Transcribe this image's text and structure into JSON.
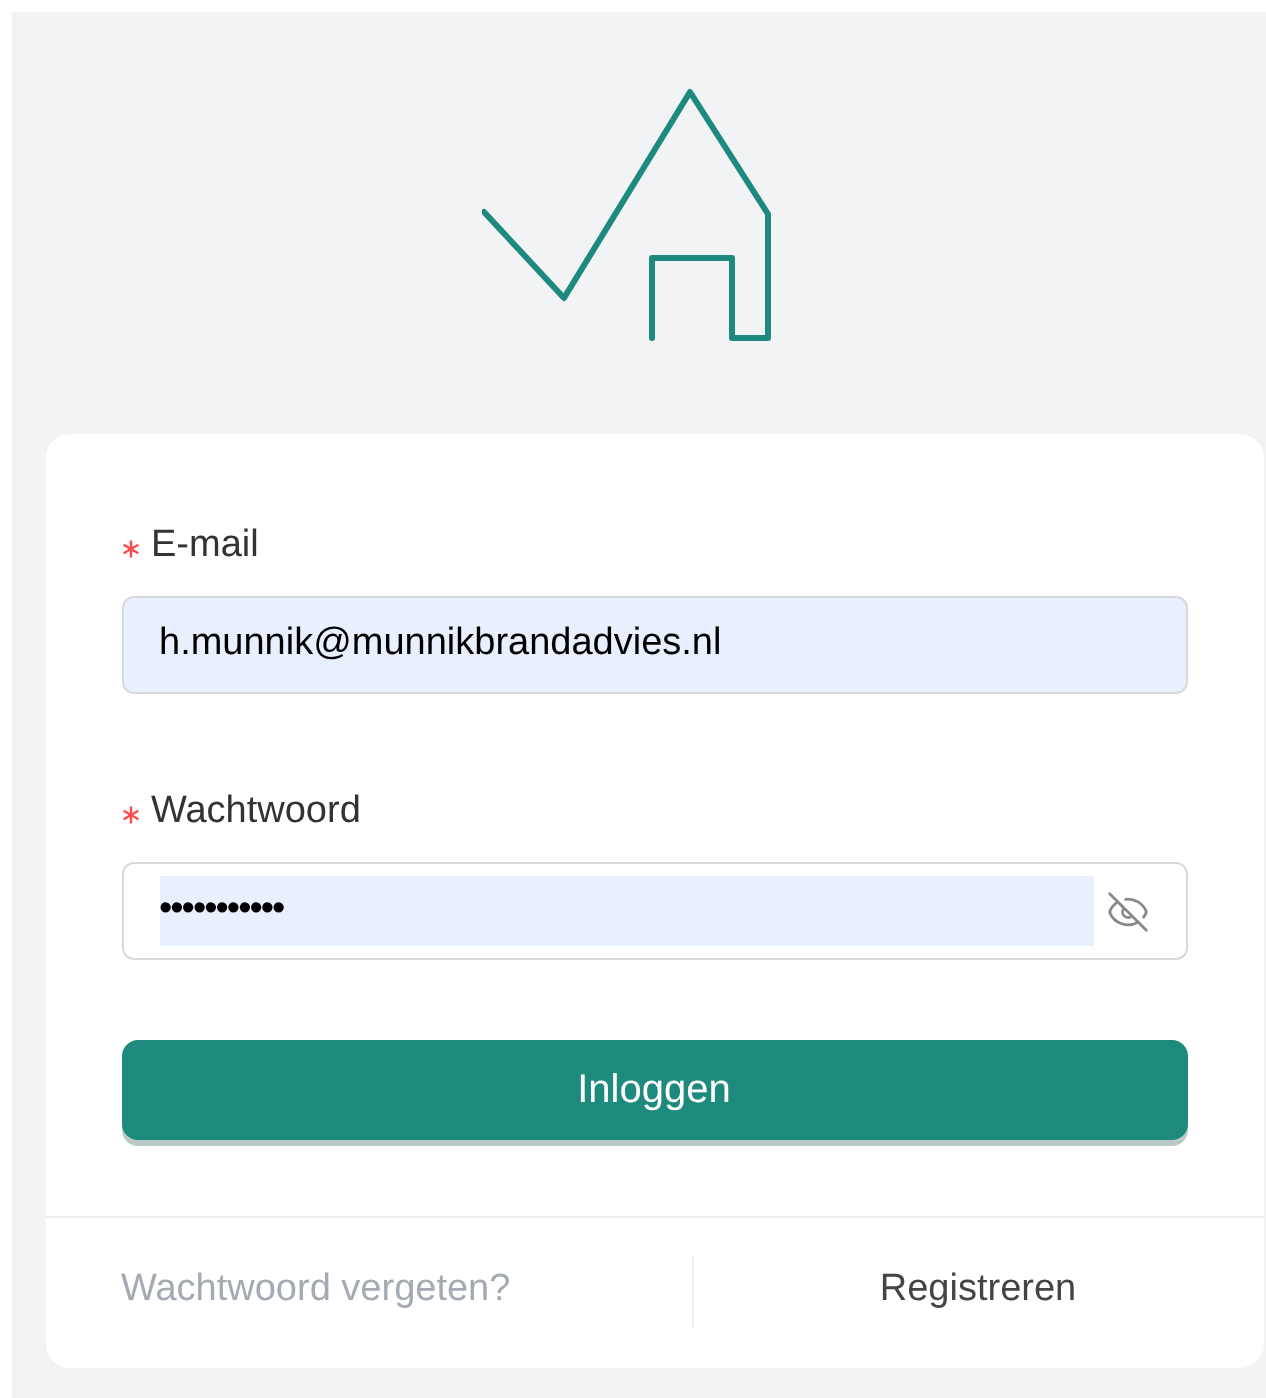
{
  "form": {
    "fields": [
      {
        "label": "E-mail",
        "required": true,
        "value": "h.munnik@munnikbrandadvies.nl",
        "kind": "text",
        "autofilled": true
      },
      {
        "label": "Wachtwoord",
        "required": true,
        "value": "•••••••••••",
        "kind": "password",
        "autofilled": true
      }
    ],
    "submit": "Inloggen"
  },
  "footer_links": [
    {
      "label": "Wachtwoord vergeten?",
      "disabled": true
    },
    {
      "label": "Registreren",
      "disabled": false
    }
  ]
}
